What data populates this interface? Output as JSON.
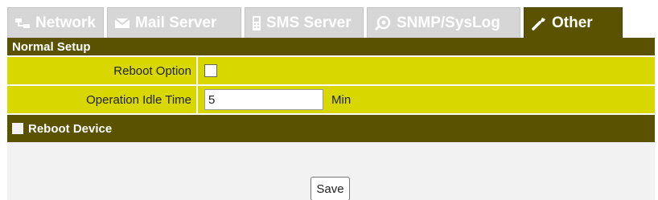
{
  "tabs": [
    {
      "label": "Network",
      "icon": "network-icon"
    },
    {
      "label": "Mail Server",
      "icon": "envelope-icon"
    },
    {
      "label": "SMS Server",
      "icon": "phone-icon"
    },
    {
      "label": "SNMP/SysLog",
      "icon": "snmp-icon"
    },
    {
      "label": "Other",
      "icon": "wrench-icon",
      "active": true
    }
  ],
  "normal_setup": {
    "title": "Normal Setup",
    "reboot_option_label": "Reboot Option",
    "reboot_option_checked": false,
    "idle_time_label": "Operation Idle Time",
    "idle_time_value": "5",
    "idle_time_unit": "Min"
  },
  "reboot_device": {
    "title": "Reboot Device"
  },
  "actions": {
    "save_label": "Save"
  },
  "colors": {
    "header": "#5b5200",
    "row": "#d8d800",
    "inactive_tab": "#d6d6d6"
  }
}
